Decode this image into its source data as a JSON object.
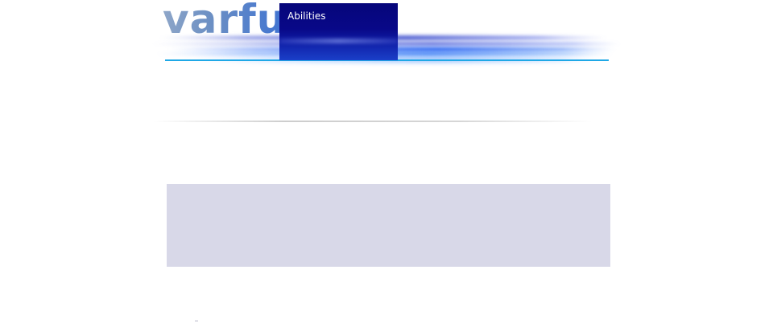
{
  "site": {
    "logo_text": "varfu"
  },
  "nav": {
    "menu_label": "Abilities"
  },
  "colors": {
    "menu_bg": "#06067a",
    "accent_line": "#1fa8e6",
    "panel_bg": "#d8d8e8",
    "logo_gradient_start": "#8ea6c8",
    "logo_gradient_end": "#3f73d2"
  }
}
